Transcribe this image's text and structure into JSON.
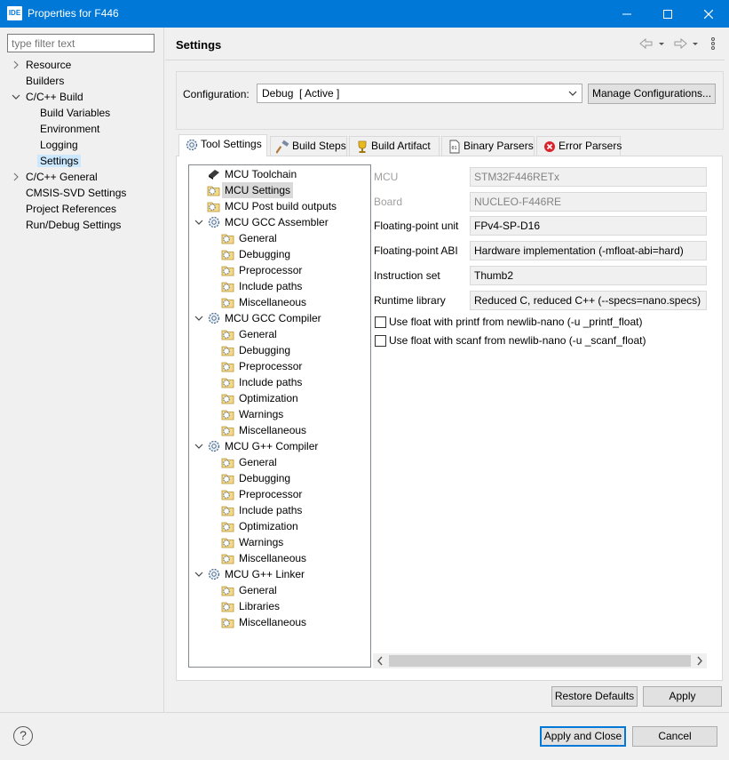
{
  "window": {
    "icon_text": "IDE",
    "title": "Properties for F446",
    "minimize_glyph": "—",
    "maximize_glyph": "☐",
    "close_glyph": "✕"
  },
  "filter": {
    "placeholder": "type filter text"
  },
  "nav": {
    "items": [
      {
        "label": "Resource",
        "level": 0,
        "expander": "collapsed"
      },
      {
        "label": "Builders",
        "level": 0,
        "expander": "none"
      },
      {
        "label": "C/C++ Build",
        "level": 0,
        "expander": "expanded"
      },
      {
        "label": "Build Variables",
        "level": 1,
        "expander": "none"
      },
      {
        "label": "Environment",
        "level": 1,
        "expander": "none"
      },
      {
        "label": "Logging",
        "level": 1,
        "expander": "none"
      },
      {
        "label": "Settings",
        "level": 1,
        "expander": "none",
        "selected": true
      },
      {
        "label": "C/C++ General",
        "level": 0,
        "expander": "collapsed"
      },
      {
        "label": "CMSIS-SVD Settings",
        "level": 0,
        "expander": "none"
      },
      {
        "label": "Project References",
        "level": 0,
        "expander": "none"
      },
      {
        "label": "Run/Debug Settings",
        "level": 0,
        "expander": "none"
      }
    ]
  },
  "header": {
    "title": "Settings"
  },
  "configuration": {
    "label": "Configuration:",
    "value": "Debug  [ Active ]",
    "manage_label": "Manage Configurations..."
  },
  "tabs": [
    {
      "label": "Tool Settings",
      "icon": "gear-icon",
      "active": true
    },
    {
      "label": "Build Steps",
      "icon": "hammer-icon"
    },
    {
      "label": "Build Artifact",
      "icon": "trophy-icon"
    },
    {
      "label": "Binary Parsers",
      "icon": "binary-file-icon"
    },
    {
      "label": "Error Parsers",
      "icon": "error-icon"
    }
  ],
  "tree": [
    {
      "label": "MCU Toolchain",
      "icon": "chip-icon",
      "level": 0
    },
    {
      "label": "MCU Settings",
      "icon": "folder-gear-icon",
      "level": 0,
      "selected": true
    },
    {
      "label": "MCU Post build outputs",
      "icon": "folder-gear-icon",
      "level": 0
    },
    {
      "label": "MCU GCC Assembler",
      "icon": "gear-icon",
      "level": 0,
      "expander": "expanded"
    },
    {
      "label": "General",
      "icon": "folder-gear-icon",
      "level": 1
    },
    {
      "label": "Debugging",
      "icon": "folder-gear-icon",
      "level": 1
    },
    {
      "label": "Preprocessor",
      "icon": "folder-gear-icon",
      "level": 1
    },
    {
      "label": "Include paths",
      "icon": "folder-gear-icon",
      "level": 1
    },
    {
      "label": "Miscellaneous",
      "icon": "folder-gear-icon",
      "level": 1
    },
    {
      "label": "MCU GCC Compiler",
      "icon": "gear-icon",
      "level": 0,
      "expander": "expanded"
    },
    {
      "label": "General",
      "icon": "folder-gear-icon",
      "level": 1
    },
    {
      "label": "Debugging",
      "icon": "folder-gear-icon",
      "level": 1
    },
    {
      "label": "Preprocessor",
      "icon": "folder-gear-icon",
      "level": 1
    },
    {
      "label": "Include paths",
      "icon": "folder-gear-icon",
      "level": 1
    },
    {
      "label": "Optimization",
      "icon": "folder-gear-icon",
      "level": 1
    },
    {
      "label": "Warnings",
      "icon": "folder-gear-icon",
      "level": 1
    },
    {
      "label": "Miscellaneous",
      "icon": "folder-gear-icon",
      "level": 1
    },
    {
      "label": "MCU G++ Compiler",
      "icon": "gear-icon",
      "level": 0,
      "expander": "expanded"
    },
    {
      "label": "General",
      "icon": "folder-gear-icon",
      "level": 1
    },
    {
      "label": "Debugging",
      "icon": "folder-gear-icon",
      "level": 1
    },
    {
      "label": "Preprocessor",
      "icon": "folder-gear-icon",
      "level": 1
    },
    {
      "label": "Include paths",
      "icon": "folder-gear-icon",
      "level": 1
    },
    {
      "label": "Optimization",
      "icon": "folder-gear-icon",
      "level": 1
    },
    {
      "label": "Warnings",
      "icon": "folder-gear-icon",
      "level": 1
    },
    {
      "label": "Miscellaneous",
      "icon": "folder-gear-icon",
      "level": 1
    },
    {
      "label": "MCU G++ Linker",
      "icon": "gear-icon",
      "level": 0,
      "expander": "expanded"
    },
    {
      "label": "General",
      "icon": "folder-gear-icon",
      "level": 1
    },
    {
      "label": "Libraries",
      "icon": "folder-gear-icon",
      "level": 1
    },
    {
      "label": "Miscellaneous",
      "icon": "folder-gear-icon",
      "level": 1
    }
  ],
  "fields": [
    {
      "label": "MCU",
      "value": "STM32F446RETx",
      "disabled": true
    },
    {
      "label": "Board",
      "value": "NUCLEO-F446RE",
      "disabled": true
    },
    {
      "label": "Floating-point unit",
      "value": "FPv4-SP-D16",
      "disabled": false
    },
    {
      "label": "Floating-point ABI",
      "value": "Hardware implementation (-mfloat-abi=hard)",
      "disabled": false
    },
    {
      "label": "Instruction set",
      "value": "Thumb2",
      "disabled": false
    },
    {
      "label": "Runtime library",
      "value": "Reduced C, reduced C++ (--specs=nano.specs)",
      "disabled": false
    }
  ],
  "checkboxes": [
    {
      "label": "Use float with printf from newlib-nano (-u _printf_float)",
      "checked": false
    },
    {
      "label": "Use float with scanf from newlib-nano (-u _scanf_float)",
      "checked": false
    }
  ],
  "buttons": {
    "restore_defaults": "Restore Defaults",
    "apply": "Apply",
    "apply_and_close": "Apply and Close",
    "cancel": "Cancel",
    "help": "?"
  },
  "colors": {
    "titlebar": "#0078d7",
    "selection": "#cce8ff",
    "tree_selection": "#d9d9d9",
    "accent": "#0078d7"
  }
}
